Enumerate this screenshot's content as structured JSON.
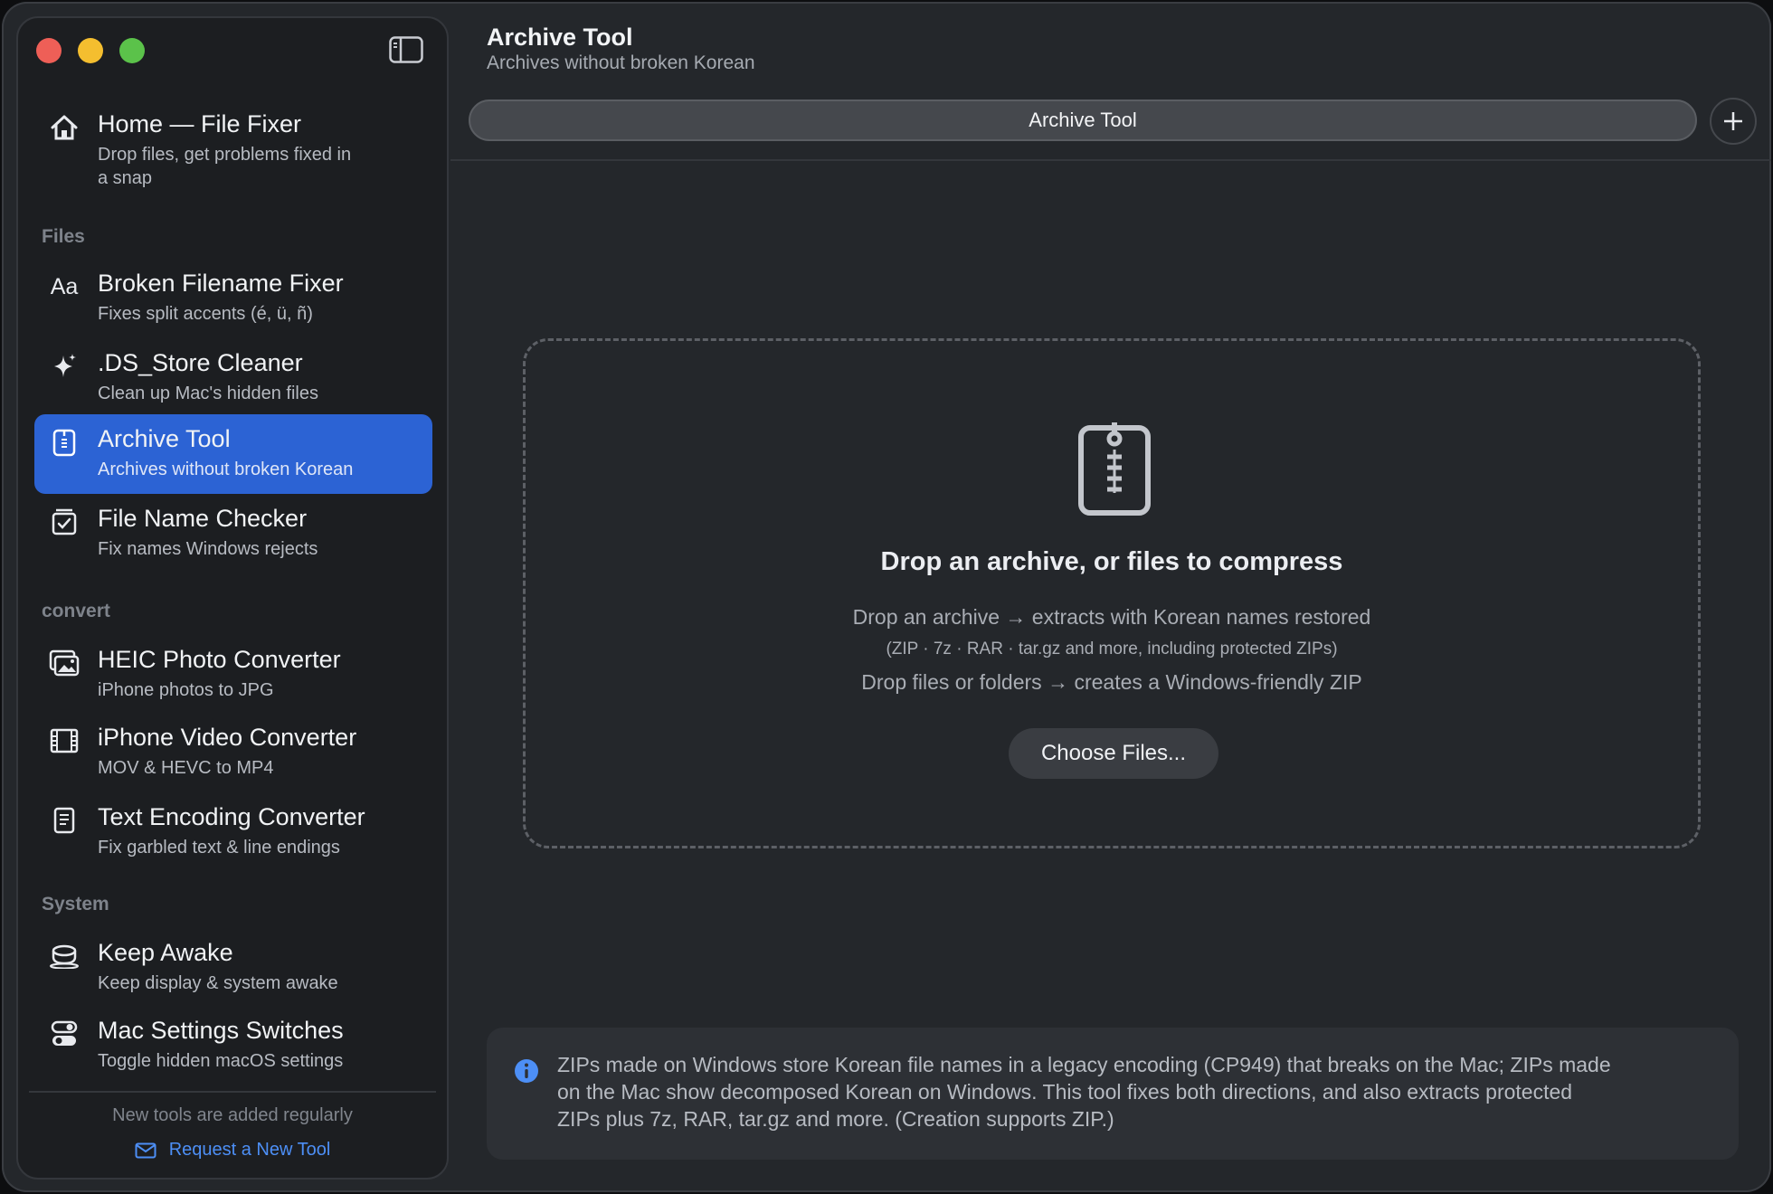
{
  "sidebar": {
    "home": {
      "title": "Home — File Fixer",
      "sub_line1": "Drop files, get problems fixed in",
      "sub_line2": "a snap"
    },
    "sections": {
      "files": "Files",
      "convert": "convert",
      "system": "System"
    },
    "items": [
      {
        "title": "Broken Filename Fixer",
        "sub": "Fixes split accents (é, ü, ñ)",
        "icon": "text-aa-icon"
      },
      {
        "title": ".DS_Store Cleaner",
        "sub": "Clean up Mac's hidden files",
        "icon": "sparkle-icon"
      },
      {
        "title": "Archive Tool",
        "sub": "Archives without broken Korean",
        "icon": "zip-doc-icon",
        "active": true
      },
      {
        "title": "File Name Checker",
        "sub": "Fix names Windows rejects",
        "icon": "checklist-icon"
      },
      {
        "title": "HEIC Photo Converter",
        "sub": "iPhone photos to JPG",
        "icon": "photos-icon"
      },
      {
        "title": "iPhone Video Converter",
        "sub": "MOV & HEVC to MP4",
        "icon": "film-icon"
      },
      {
        "title": "Text Encoding Converter",
        "sub": "Fix garbled text & line endings",
        "icon": "document-icon"
      },
      {
        "title": "Keep Awake",
        "sub": "Keep display & system awake",
        "icon": "coffee-cup-icon"
      },
      {
        "title": "Mac Settings Switches",
        "sub": "Toggle hidden macOS settings",
        "icon": "toggles-icon"
      }
    ],
    "footer_note": "New tools are added regularly",
    "request_label": "Request a New Tool"
  },
  "header": {
    "title": "Archive Tool",
    "subtitle": "Archives without broken Korean"
  },
  "tabbar": {
    "tab_label": "Archive Tool"
  },
  "dropzone": {
    "title": "Drop an archive, or files to compress",
    "line1": "Drop an archive → extracts with Korean names restored",
    "line2": "(ZIP · 7z · RAR · tar.gz and more, including protected ZIPs)",
    "line3": "Drop files or folders → creates a Windows-friendly ZIP",
    "button": "Choose Files..."
  },
  "info": {
    "line1": "ZIPs made on Windows store Korean file names in a legacy encoding (CP949) that breaks on the Mac; ZIPs made",
    "line2": "on the Mac show decomposed Korean on Windows. This tool fixes both directions, and also extracts protected",
    "line3": "ZIPs plus 7z, RAR, tar.gz and more. (Creation supports ZIP.)"
  },
  "colors": {
    "accent": "#2c63d4",
    "link": "#4d8ff6",
    "info": "#4d8ff6"
  }
}
